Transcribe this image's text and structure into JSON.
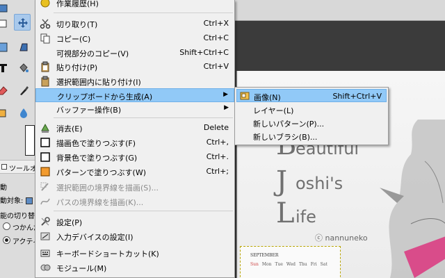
{
  "toolbox": {
    "tool_options_label": "ツールオプ",
    "line1": "動",
    "line2": "動対象:",
    "line3": "能の切り替え",
    "radio1": "つかんだ",
    "radio2": "アクティ"
  },
  "menu": {
    "top_item": "作業履歴(H)",
    "items": [
      {
        "label": "切り取り(T)",
        "shortcut": "Ctrl+X"
      },
      {
        "label": "コピー(C)",
        "shortcut": "Ctrl+C"
      },
      {
        "label": "可視部分のコピー(V)",
        "shortcut": "Shift+Ctrl+C"
      },
      {
        "label": "貼り付け(P)",
        "shortcut": "Ctrl+V"
      },
      {
        "label": "選択範囲内に貼り付け(I)",
        "shortcut": ""
      },
      {
        "label": "クリップボードから生成(A)",
        "shortcut": ""
      },
      {
        "label": "バッファー操作(B)",
        "shortcut": ""
      },
      {
        "label": "消去(E)",
        "shortcut": "Delete"
      },
      {
        "label": "描画色で塗りつぶす(F)",
        "shortcut": "Ctrl+,"
      },
      {
        "label": "背景色で塗りつぶす(G)",
        "shortcut": "Ctrl+."
      },
      {
        "label": "パターンで塗りつぶす(W)",
        "shortcut": "Ctrl+;"
      },
      {
        "label": "選択範囲の境界線を描画(S)...",
        "shortcut": ""
      },
      {
        "label": "パスの境界線を描画(K)...",
        "shortcut": ""
      },
      {
        "label": "設定(P)",
        "shortcut": ""
      },
      {
        "label": "入力デバイスの設定(I)",
        "shortcut": ""
      },
      {
        "label": "キーボードショートカット(K)",
        "shortcut": ""
      },
      {
        "label": "モジュール(M)",
        "shortcut": ""
      }
    ]
  },
  "submenu": {
    "items": [
      {
        "label": "画像(N)",
        "shortcut": "Shift+Ctrl+V"
      },
      {
        "label": "レイヤー(L)",
        "shortcut": ""
      },
      {
        "label": "新しいパターン(P)...",
        "shortcut": ""
      },
      {
        "label": "新しいブラシ(B)...",
        "shortcut": ""
      }
    ]
  },
  "canvas": {
    "line1_cap": "B",
    "line1_rest": "eautiful",
    "line2_cap": "J",
    "line2_rest": "oshi's",
    "line3_cap": "L",
    "line3_rest": "ife",
    "credit": "ⓒ nannuneko",
    "calendar_month": "SEPTEMBER",
    "calendar_days": [
      "Sun",
      "Mon",
      "Tue",
      "Wed",
      "Thu",
      "Fri",
      "Sat"
    ]
  },
  "colors": {
    "highlight": "#91c9f7",
    "menu_bg": "#f0f0f0",
    "disabled_text": "#8a8a8a"
  }
}
